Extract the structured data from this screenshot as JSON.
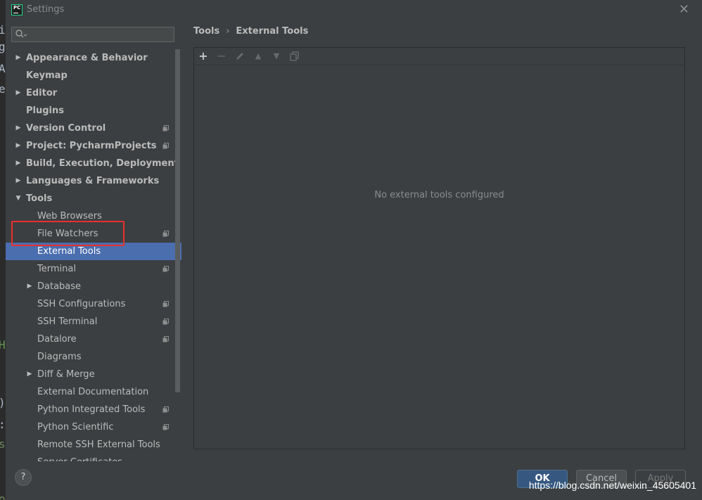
{
  "background_editor": {
    "fragments": [
      "i",
      "g",
      "A",
      "e",
      "H",
      ")",
      ":",
      "s",
      "o\")"
    ]
  },
  "window": {
    "title": "Settings",
    "logo_text": "PC"
  },
  "search": {
    "placeholder": "Q-"
  },
  "tree": [
    {
      "label": "Appearance & Behavior",
      "level": 0,
      "expandable": true,
      "expanded": false,
      "project_icon": false,
      "selected": false
    },
    {
      "label": "Keymap",
      "level": 0,
      "expandable": false,
      "expanded": false,
      "project_icon": false,
      "selected": false
    },
    {
      "label": "Editor",
      "level": 0,
      "expandable": true,
      "expanded": false,
      "project_icon": false,
      "selected": false
    },
    {
      "label": "Plugins",
      "level": 0,
      "expandable": false,
      "expanded": false,
      "project_icon": false,
      "selected": false
    },
    {
      "label": "Version Control",
      "level": 0,
      "expandable": true,
      "expanded": false,
      "project_icon": true,
      "selected": false
    },
    {
      "label": "Project: PycharmProjects",
      "level": 0,
      "expandable": true,
      "expanded": false,
      "project_icon": true,
      "selected": false
    },
    {
      "label": "Build, Execution, Deployment",
      "level": 0,
      "expandable": true,
      "expanded": false,
      "project_icon": false,
      "selected": false
    },
    {
      "label": "Languages & Frameworks",
      "level": 0,
      "expandable": true,
      "expanded": false,
      "project_icon": false,
      "selected": false
    },
    {
      "label": "Tools",
      "level": 0,
      "expandable": true,
      "expanded": true,
      "project_icon": false,
      "selected": false
    },
    {
      "label": "Web Browsers",
      "level": 1,
      "expandable": false,
      "expanded": false,
      "project_icon": false,
      "selected": false
    },
    {
      "label": "File Watchers",
      "level": 1,
      "expandable": false,
      "expanded": false,
      "project_icon": true,
      "selected": false
    },
    {
      "label": "External Tools",
      "level": 1,
      "expandable": false,
      "expanded": false,
      "project_icon": false,
      "selected": true
    },
    {
      "label": "Terminal",
      "level": 1,
      "expandable": false,
      "expanded": false,
      "project_icon": true,
      "selected": false
    },
    {
      "label": "Database",
      "level": 1,
      "expandable": true,
      "expanded": false,
      "project_icon": false,
      "selected": false
    },
    {
      "label": "SSH Configurations",
      "level": 1,
      "expandable": false,
      "expanded": false,
      "project_icon": true,
      "selected": false
    },
    {
      "label": "SSH Terminal",
      "level": 1,
      "expandable": false,
      "expanded": false,
      "project_icon": true,
      "selected": false
    },
    {
      "label": "Datalore",
      "level": 1,
      "expandable": false,
      "expanded": false,
      "project_icon": true,
      "selected": false
    },
    {
      "label": "Diagrams",
      "level": 1,
      "expandable": false,
      "expanded": false,
      "project_icon": false,
      "selected": false
    },
    {
      "label": "Diff & Merge",
      "level": 1,
      "expandable": true,
      "expanded": false,
      "project_icon": false,
      "selected": false
    },
    {
      "label": "External Documentation",
      "level": 1,
      "expandable": false,
      "expanded": false,
      "project_icon": false,
      "selected": false
    },
    {
      "label": "Python Integrated Tools",
      "level": 1,
      "expandable": false,
      "expanded": false,
      "project_icon": true,
      "selected": false
    },
    {
      "label": "Python Scientific",
      "level": 1,
      "expandable": false,
      "expanded": false,
      "project_icon": true,
      "selected": false
    },
    {
      "label": "Remote SSH External Tools",
      "level": 1,
      "expandable": false,
      "expanded": false,
      "project_icon": false,
      "selected": false
    },
    {
      "label": "Server Certificates",
      "level": 1,
      "expandable": false,
      "expanded": false,
      "project_icon": false,
      "selected": false
    }
  ],
  "breadcrumb": {
    "parent": "Tools",
    "separator": "›",
    "current": "External Tools"
  },
  "toolbar": {
    "add_icon": "plus-icon",
    "remove_icon": "minus-icon",
    "edit_icon": "pencil-icon",
    "up_icon": "triangle-up-icon",
    "down_icon": "triangle-down-icon",
    "copy_icon": "copy-icon"
  },
  "main": {
    "empty_text": "No external tools configured"
  },
  "buttons": {
    "help": "?",
    "ok": "OK",
    "cancel": "Cancel",
    "apply": "Apply"
  },
  "watermark": "https://blog.csdn.net/weixin_45605401",
  "colors": {
    "background": "#3c3f41",
    "selection": "#4b6eaf",
    "highlight_box": "#e8312c",
    "ok_button": "#365880"
  }
}
